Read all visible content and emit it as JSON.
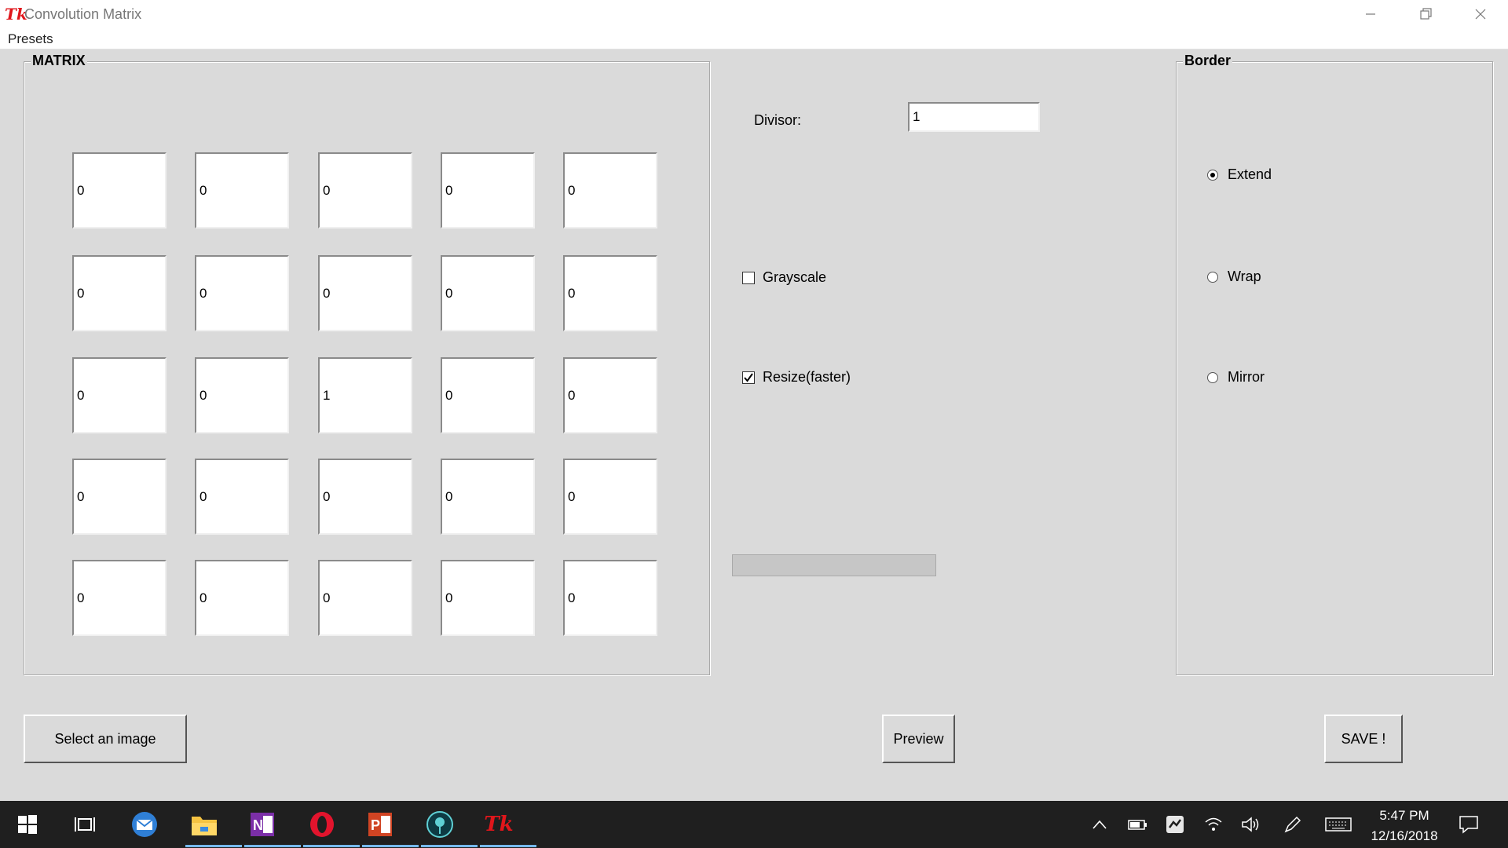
{
  "window": {
    "title": "Convolution Matrix",
    "logo": "Tk"
  },
  "menu": {
    "presets": "Presets"
  },
  "matrix": {
    "label": "MATRIX",
    "rows": [
      [
        "0",
        "0",
        "0",
        "0",
        "0"
      ],
      [
        "0",
        "0",
        "0",
        "0",
        "0"
      ],
      [
        "0",
        "0",
        "1",
        "0",
        "0"
      ],
      [
        "0",
        "0",
        "0",
        "0",
        "0"
      ],
      [
        "0",
        "0",
        "0",
        "0",
        "0"
      ]
    ]
  },
  "options": {
    "divisor_label": "Divisor:",
    "divisor_value": "1",
    "grayscale_label": "Grayscale",
    "grayscale_checked": false,
    "resize_label": "Resize(faster)",
    "resize_checked": true,
    "progress": 0
  },
  "border": {
    "label": "Border",
    "options": [
      "Extend",
      "Wrap",
      "Mirror"
    ],
    "selected": "Extend"
  },
  "buttons": {
    "select_image": "Select an image",
    "preview": "Preview",
    "save": "SAVE !"
  },
  "taskbar": {
    "time": "5:47 PM",
    "date": "12/16/2018"
  },
  "colors": {
    "tk_logo": "#e0161b",
    "progress_fill": "#06b025"
  }
}
